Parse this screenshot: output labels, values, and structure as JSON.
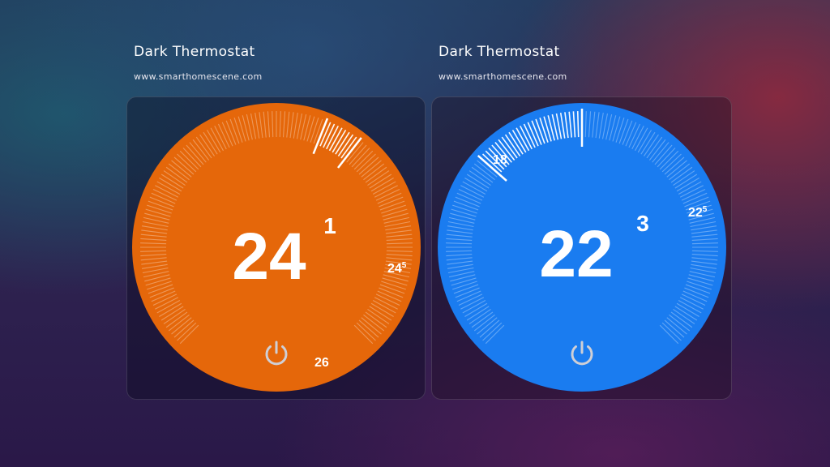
{
  "thermostats": [
    {
      "title": "Dark Thermostat",
      "site": "www.smarthomescene.com",
      "mode": "heat",
      "color": "#e5670a",
      "current_int": "24",
      "current_dec": "1",
      "current_marker_int": "24",
      "current_marker_dec": "5",
      "target": "26",
      "current_value": 24.5,
      "target_value": 26,
      "power_icon": "power-icon"
    },
    {
      "title": "Dark Thermostat",
      "site": "www.smarthomescene.com",
      "mode": "cool",
      "color": "#1a7cf0",
      "current_int": "22",
      "current_dec": "3",
      "current_marker_int": "22",
      "current_marker_dec": "5",
      "target": "18",
      "current_value": 22.5,
      "target_value": 18,
      "power_icon": "power-icon"
    }
  ]
}
